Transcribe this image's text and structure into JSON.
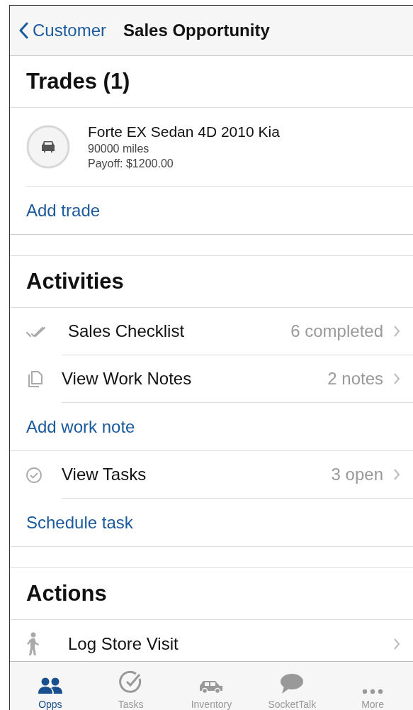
{
  "nav": {
    "back": "Customer",
    "title": "Sales Opportunity"
  },
  "trades": {
    "title": "Trades (1)",
    "items": [
      {
        "name": "Forte EX Sedan 4D 2010 Kia",
        "miles": "90000 miles",
        "payoff": "Payoff: $1200.00"
      }
    ],
    "add": "Add trade"
  },
  "activities": {
    "title": "Activities",
    "items": [
      {
        "kind": "nav",
        "label": "Sales Checklist",
        "value": "6 completed"
      },
      {
        "kind": "nav",
        "label": "View Work Notes",
        "value": "2 notes"
      },
      {
        "kind": "link",
        "label": "Add work note"
      },
      {
        "kind": "nav",
        "label": "View Tasks",
        "value": "3 open"
      },
      {
        "kind": "link",
        "label": "Schedule task"
      }
    ]
  },
  "actions": {
    "title": "Actions",
    "items": [
      {
        "kind": "nav",
        "label": "Log Store Visit"
      }
    ]
  },
  "tabs": [
    {
      "label": "Opps",
      "selected": true
    },
    {
      "label": "Tasks",
      "selected": false
    },
    {
      "label": "Inventory",
      "selected": false
    },
    {
      "label": "SocketTalk",
      "selected": false
    },
    {
      "label": "More",
      "selected": false
    }
  ]
}
